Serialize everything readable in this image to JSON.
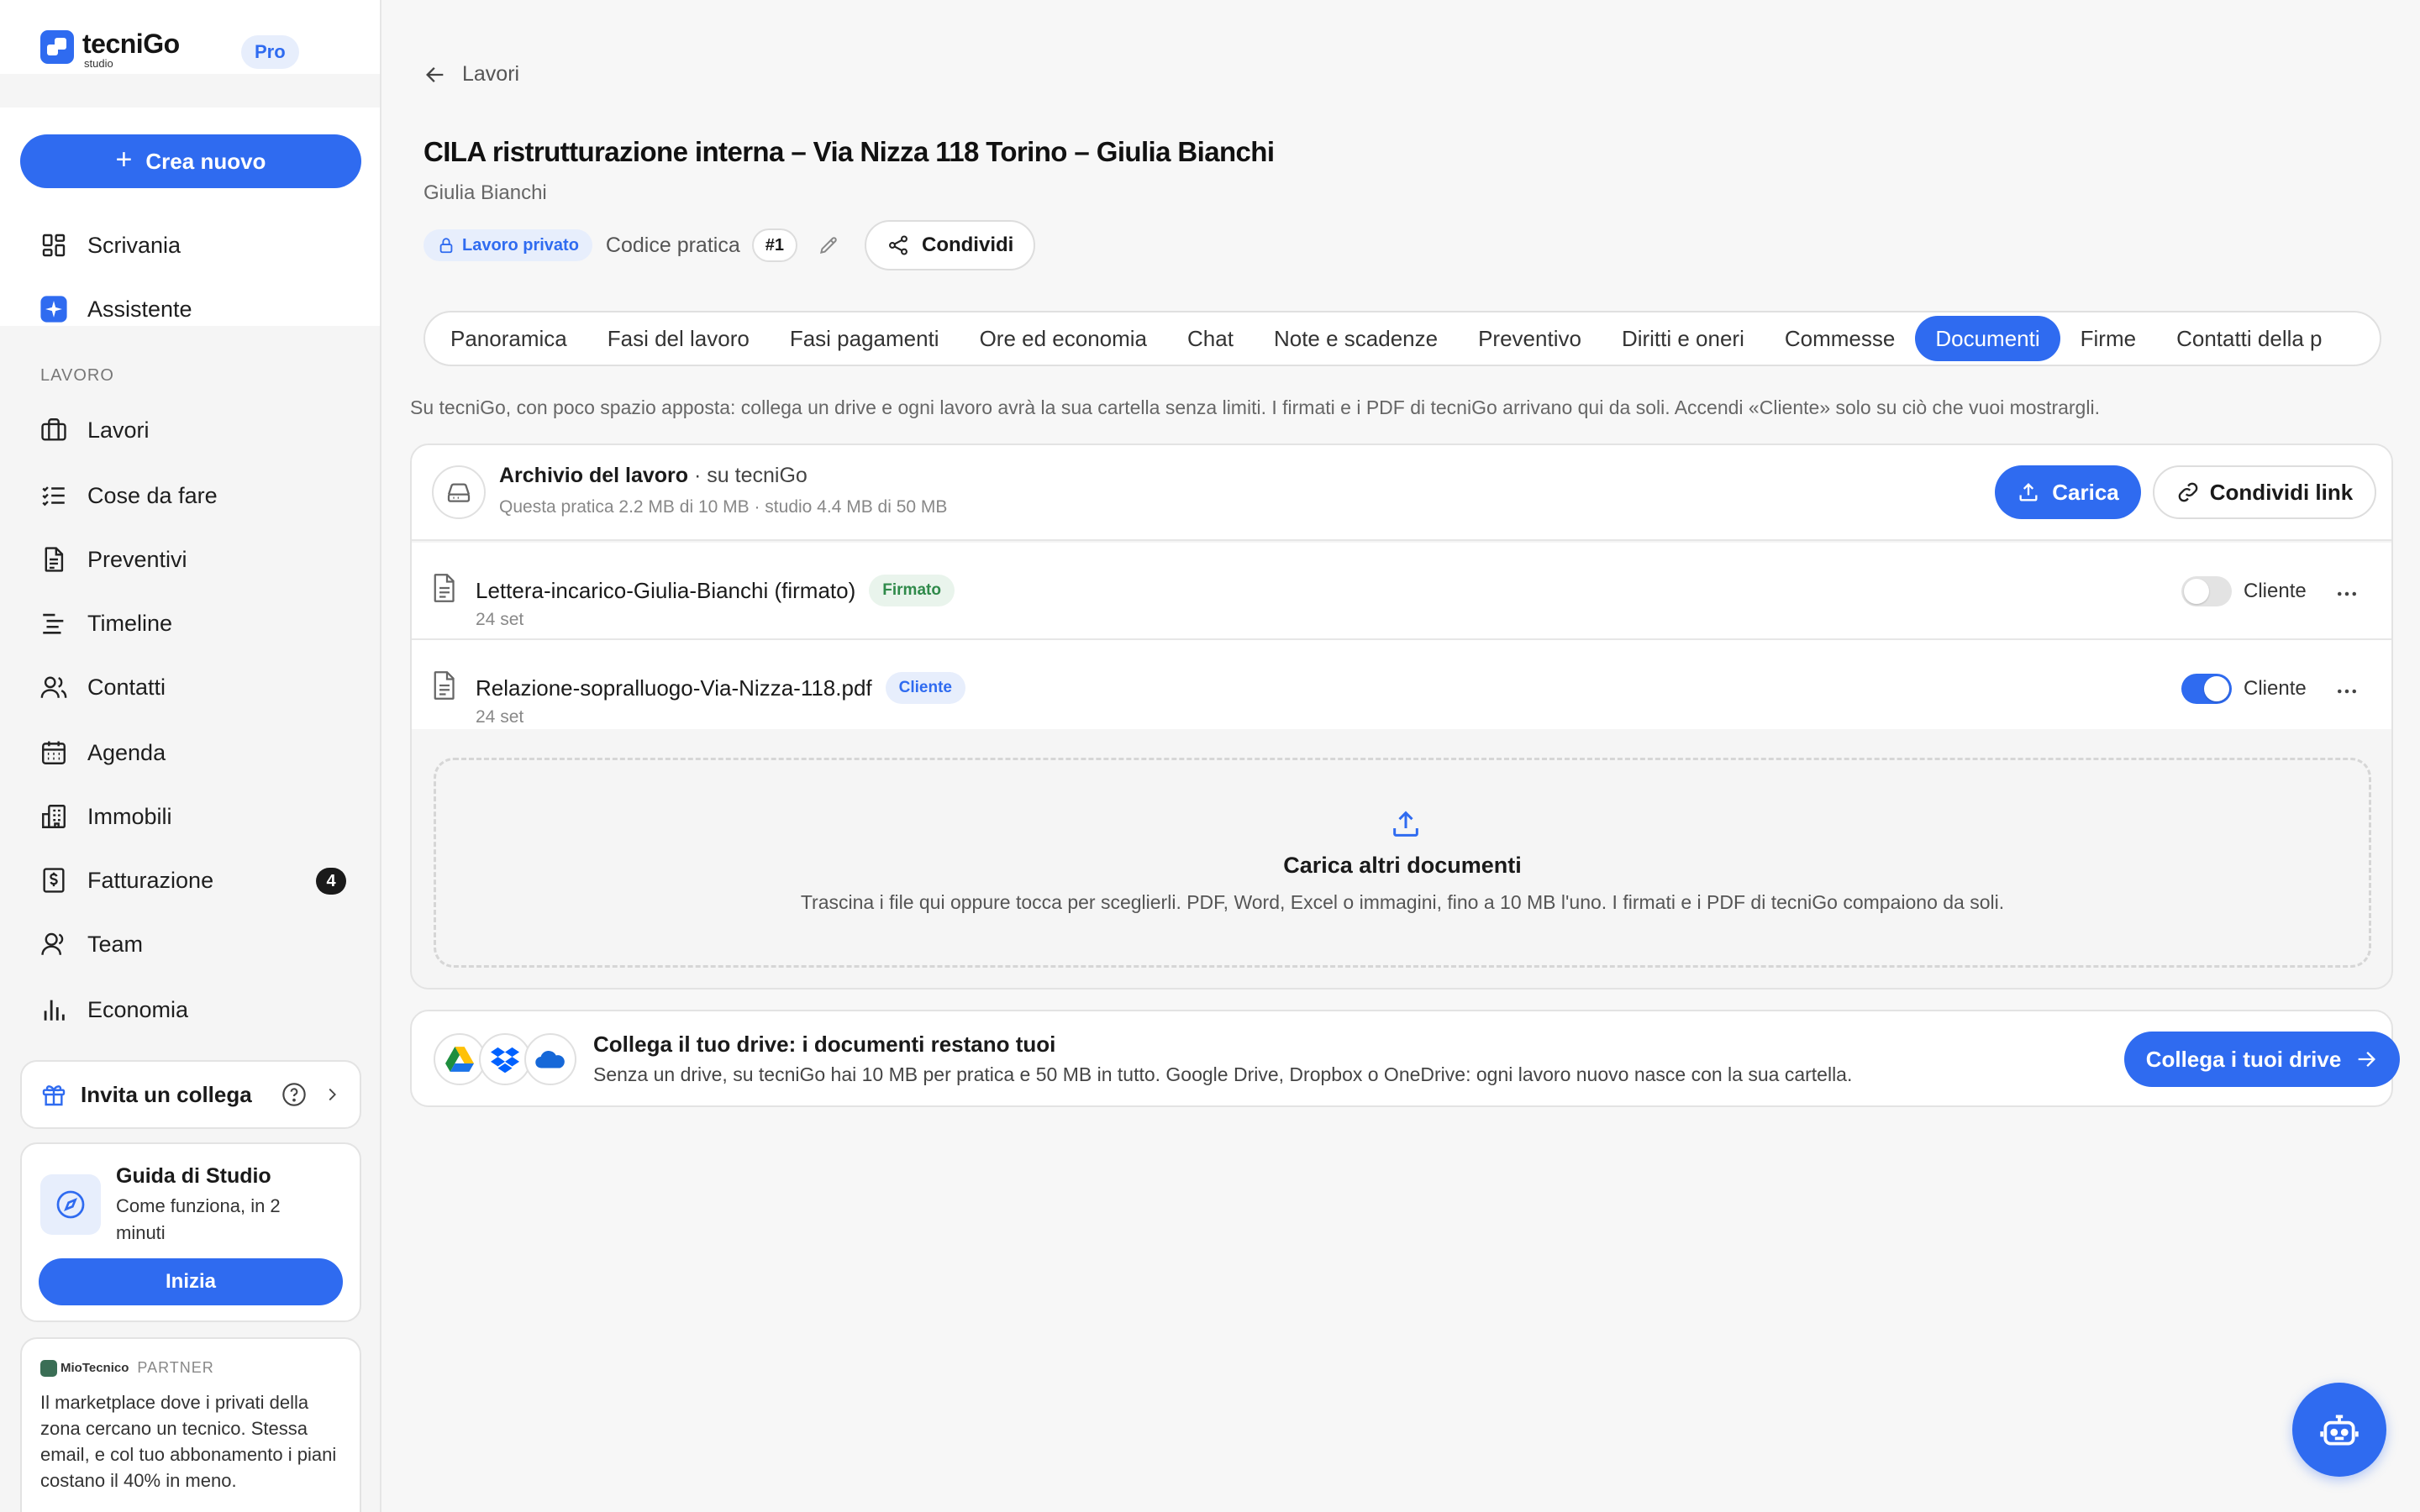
{
  "brand": {
    "name": "tecniGo",
    "sub": "studio",
    "plan": "Pro"
  },
  "sidebar": {
    "create_label": "Crea nuovo",
    "top_items": [
      {
        "label": "Scrivania",
        "icon": "dashboard-icon"
      },
      {
        "label": "Assistente",
        "icon": "sparkle-icon"
      }
    ],
    "section_label": "LAVORO",
    "items": [
      {
        "label": "Lavori",
        "icon": "briefcase-icon"
      },
      {
        "label": "Cose da fare",
        "icon": "checklist-icon"
      },
      {
        "label": "Preventivi",
        "icon": "document-icon"
      },
      {
        "label": "Timeline",
        "icon": "timeline-icon"
      },
      {
        "label": "Contatti",
        "icon": "users-icon"
      },
      {
        "label": "Agenda",
        "icon": "calendar-icon"
      },
      {
        "label": "Immobili",
        "icon": "building-icon"
      },
      {
        "label": "Fatturazione",
        "icon": "invoice-icon",
        "badge": "4"
      },
      {
        "label": "Team",
        "icon": "team-icon"
      },
      {
        "label": "Economia",
        "icon": "bar-chart-icon"
      }
    ],
    "invite_label": "Invita un collega",
    "guide": {
      "title": "Guida di Studio",
      "desc": "Come funziona, in 2 minuti",
      "button": "Inizia"
    },
    "partner": {
      "logo": "MioTecnico",
      "tag": "PARTNER",
      "text": "Il marketplace dove i privati della zona cercano un tecnico. Stessa email, e col tuo abbonamento i piani costano il 40% in meno."
    }
  },
  "header": {
    "back_label": "Lavori",
    "title": "CILA ristrutturazione interna – Via Nizza 118 Torino – Giulia Bianchi",
    "client": "Giulia Bianchi",
    "private_label": "Lavoro privato",
    "code_label": "Codice pratica",
    "code_value": "#1",
    "share_label": "Condividi"
  },
  "tabs": [
    {
      "label": "Panoramica",
      "active": false
    },
    {
      "label": "Fasi del lavoro",
      "active": false
    },
    {
      "label": "Fasi pagamenti",
      "active": false
    },
    {
      "label": "Ore ed economia",
      "active": false
    },
    {
      "label": "Chat",
      "active": false
    },
    {
      "label": "Note e scadenze",
      "active": false
    },
    {
      "label": "Preventivo",
      "active": false
    },
    {
      "label": "Diritti e oneri",
      "active": false
    },
    {
      "label": "Commesse",
      "active": false
    },
    {
      "label": "Documenti",
      "active": true
    },
    {
      "label": "Firme",
      "active": false
    },
    {
      "label": "Contatti della p",
      "active": false
    }
  ],
  "documents": {
    "info": "Su tecniGo, con poco spazio apposta: collega un drive e ogni lavoro avrà la sua cartella senza limiti. I firmati e i PDF di tecniGo arrivano qui da soli. Accendi «Cliente» solo su ciò che vuoi mostrargli.",
    "archive": {
      "title": "Archivio del lavoro",
      "title_suffix": "· su tecniGo",
      "usage": "Questa pratica 2.2 MB di 10 MB · studio 4.4 MB di 50 MB",
      "upload_label": "Carica",
      "share_link_label": "Condividi link"
    },
    "files": [
      {
        "name": "Lettera-incarico-Giulia-Bianchi (firmato)",
        "tag": "Firmato",
        "tag_color": "#2f8a4a",
        "date": "24 set",
        "client_visible": false,
        "toggle_label": "Cliente"
      },
      {
        "name": "Relazione-sopralluogo-Via-Nizza-118.pdf",
        "tag": "Cliente",
        "tag_color": "#2f6bf0",
        "date": "24 set",
        "client_visible": true,
        "toggle_label": "Cliente"
      }
    ],
    "dropzone": {
      "title": "Carica altri documenti",
      "desc": "Trascina i file qui oppure tocca per sceglierli. PDF, Word, Excel o immagini, fino a 10 MB l'uno. I firmati e i PDF di tecniGo compaiono da soli."
    },
    "drive": {
      "title": "Collega il tuo drive: i documenti restano tuoi",
      "desc": "Senza un drive, su tecniGo hai 10 MB per pratica e 50 MB in tutto. Google Drive, Dropbox o OneDrive: ogni lavoro nuovo nasce con la sua cartella.",
      "button": "Collega i tuoi drive",
      "providers": [
        "google-drive-icon",
        "dropbox-icon",
        "onedrive-icon"
      ]
    }
  },
  "colors": {
    "accent": "#2f6bf0",
    "badge_dark": "#1a1a1a",
    "signed_green": "#2f8a4a"
  }
}
